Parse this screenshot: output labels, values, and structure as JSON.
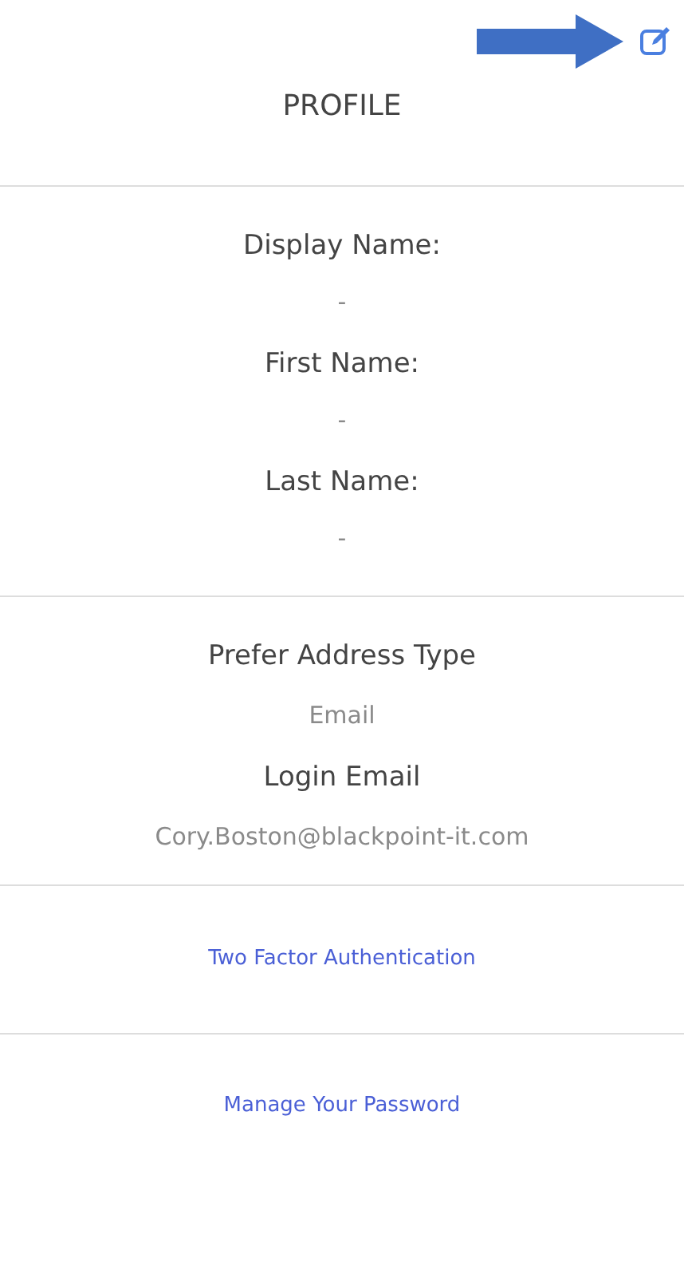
{
  "title": "PROFILE",
  "name_fields": [
    {
      "label": "Display Name:",
      "value": "-"
    },
    {
      "label": "First Name:",
      "value": "-"
    },
    {
      "label": "Last Name:",
      "value": "-"
    }
  ],
  "contact_fields": [
    {
      "label": "Prefer Address Type",
      "value": "Email"
    },
    {
      "label": "Login Email",
      "value": "Cory.Boston@blackpoint-it.com"
    }
  ],
  "links": [
    "Two Factor Authentication",
    "Manage Your Password"
  ]
}
